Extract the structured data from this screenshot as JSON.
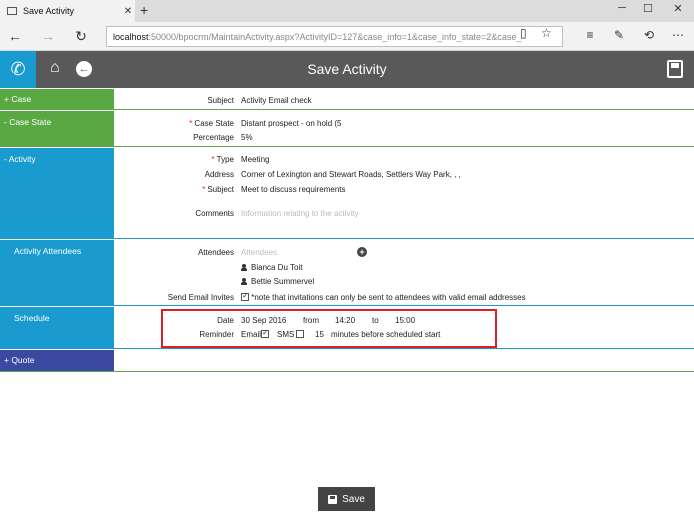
{
  "browser": {
    "tab_title": "Save Activity",
    "tab_close": "✕",
    "new_tab": "+",
    "url_host": "localhost",
    "url_path": ":50000/bpocrm/MaintainActivity.aspx?ActivityID=127&case_info=1&case_info_state=2&case_"
  },
  "app": {
    "title": "Save Activity"
  },
  "sections": {
    "case": {
      "label": "+ Case",
      "subject_label": "Subject",
      "subject_value": "Activity Email check"
    },
    "case_state": {
      "label": "- Case State",
      "state_label": "Case State",
      "state_value": "Distant prospect - on hold (5",
      "percentage_label": "Percentage",
      "percentage_value": "5%"
    },
    "activity": {
      "label": "- Activity",
      "type_label": "Type",
      "type_value": "Meeting",
      "address_label": "Address",
      "address_value": "Corner of Lexington and Stewart Roads, Settlers Way Park, , ,",
      "subject_label": "Subject",
      "subject_value": "Meet to discuss requirements",
      "comments_label": "Comments",
      "comments_placeholder": "Information relating to the activity"
    },
    "attendees": {
      "label": "Activity Attendees",
      "attendees_label": "Attendees",
      "attendees_placeholder": "Attendees",
      "people": [
        "Bianca Du Toit",
        "Bettie Summervel"
      ],
      "send_label": "Send Email Invites",
      "send_note": "*note that invitations can only be sent to attendees with valid email addresses"
    },
    "schedule": {
      "label": "Schedule",
      "date_label": "Date",
      "date_value": "30 Sep 2016",
      "from_label": "from",
      "from_value": "14:20",
      "to_label": "to",
      "to_value": "15:00",
      "reminder_label": "Reminder",
      "email_label": "Email",
      "sms_label": "SMS",
      "minutes_value": "15",
      "minutes_suffix": "minutes before scheduled start"
    },
    "quote": {
      "label": "+ Quote"
    }
  },
  "footer": {
    "save_label": "Save"
  },
  "colors": {
    "case": "#5aa844",
    "case_state": "#5aa844",
    "activity": "#1a9bd0",
    "attendees": "#1a9bd0",
    "schedule": "#1a9bd0",
    "quote": "#3b4aa0",
    "highlight": "#d9202a"
  }
}
